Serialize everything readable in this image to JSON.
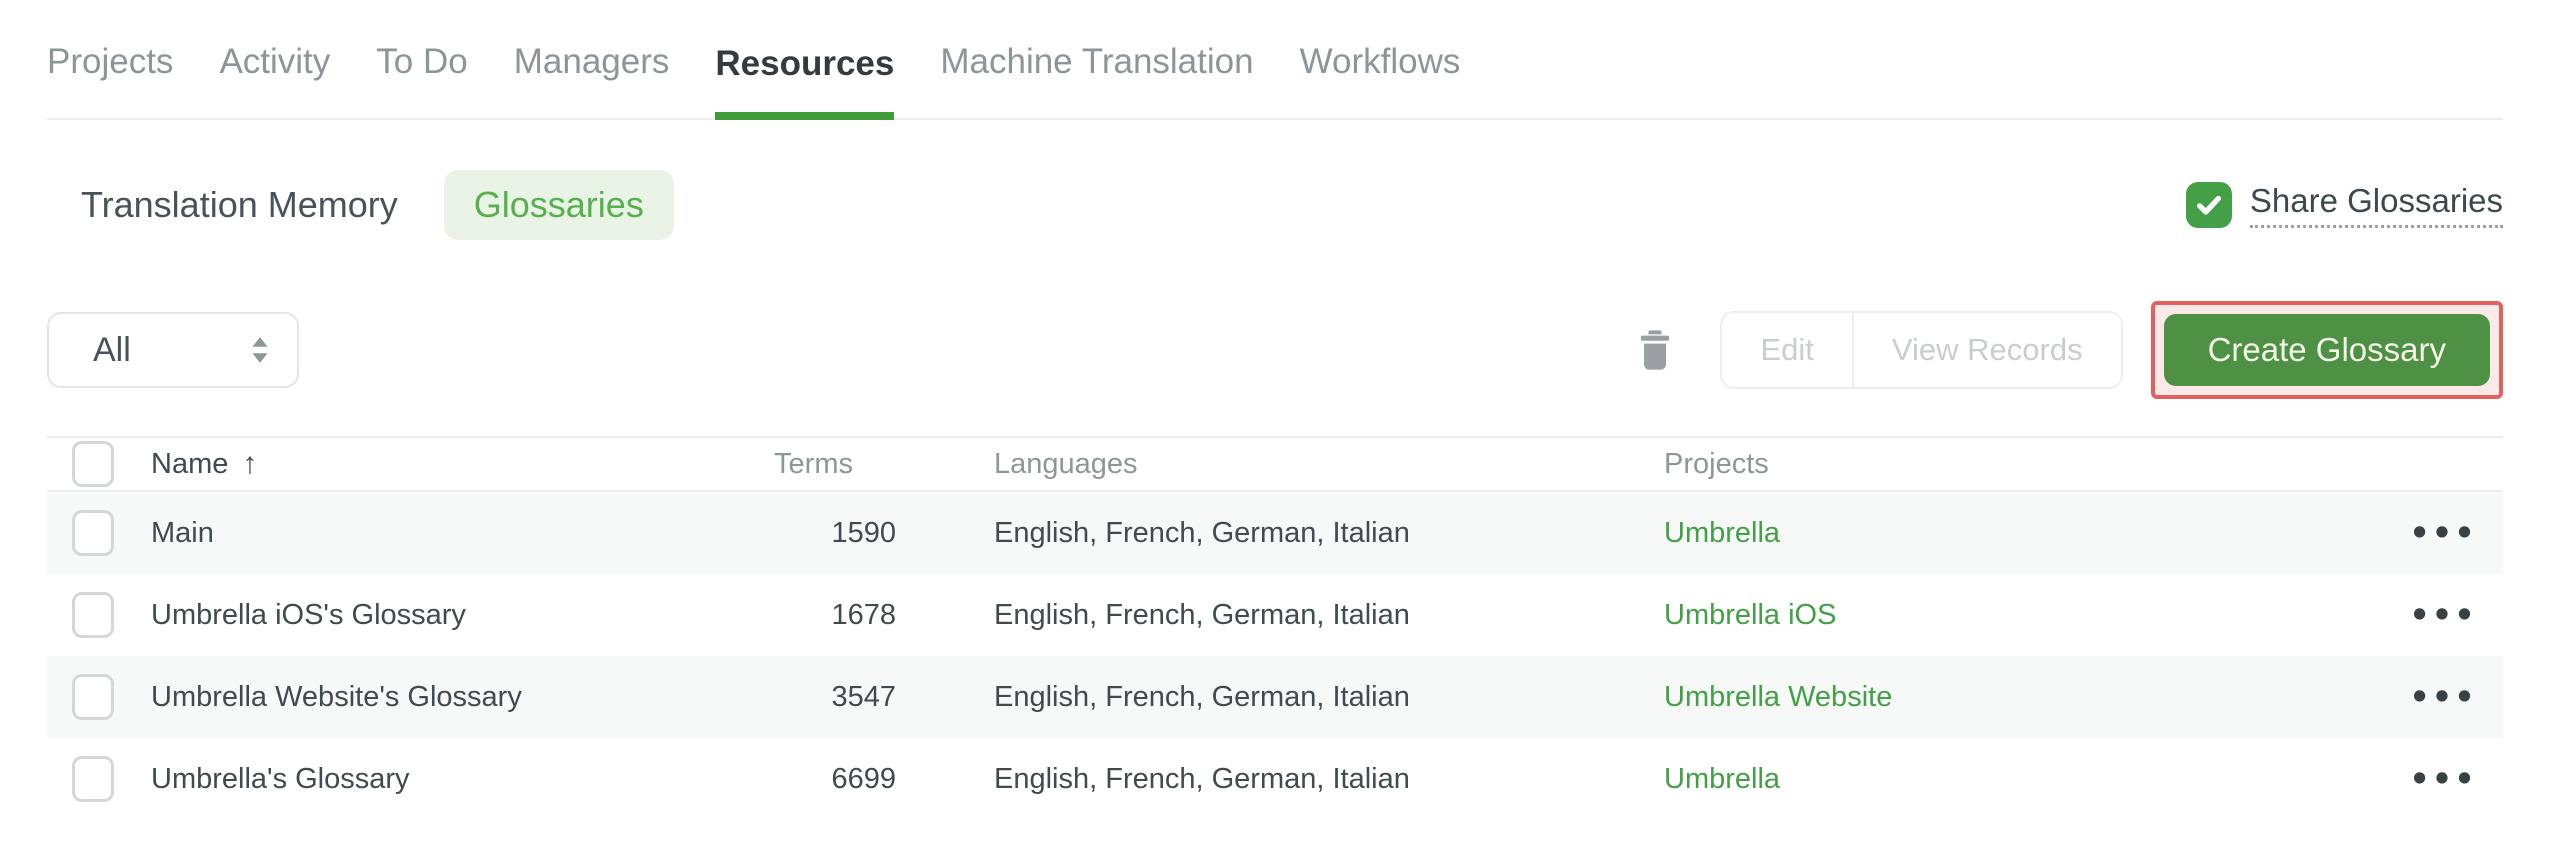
{
  "nav": {
    "tabs": [
      {
        "label": "Projects",
        "active": false
      },
      {
        "label": "Activity",
        "active": false
      },
      {
        "label": "To Do",
        "active": false
      },
      {
        "label": "Managers",
        "active": false
      },
      {
        "label": "Resources",
        "active": true
      },
      {
        "label": "Machine Translation",
        "active": false
      },
      {
        "label": "Workflows",
        "active": false
      }
    ]
  },
  "subnav": {
    "tabs": [
      {
        "label": "Translation Memory",
        "active": false
      },
      {
        "label": "Glossaries",
        "active": true
      }
    ],
    "share": {
      "label": "Share Glossaries",
      "checked": true
    }
  },
  "toolbar": {
    "filter": {
      "value": "All"
    },
    "edit_label": "Edit",
    "view_records_label": "View Records",
    "create_label": "Create Glossary"
  },
  "icons": {
    "trash": "trash-icon",
    "filter_caret": "sort-caret-icon",
    "share_check": "checkmark-icon",
    "sort_asc": "sort-ascending-arrow-icon",
    "row_menu": "ellipsis-icon"
  },
  "table": {
    "columns": [
      "Name",
      "Terms",
      "Languages",
      "Projects"
    ],
    "sort": {
      "column": "Name",
      "direction": "asc",
      "arrow": "↑"
    },
    "row_menu_icon": "•••",
    "rows": [
      {
        "name": "Main",
        "terms": "1590",
        "languages": "English, French, German, Italian",
        "project": "Umbrella"
      },
      {
        "name": "Umbrella iOS's Glossary",
        "terms": "1678",
        "languages": "English, French, German, Italian",
        "project": "Umbrella iOS"
      },
      {
        "name": "Umbrella Website's Glossary",
        "terms": "3547",
        "languages": "English, French, German, Italian",
        "project": "Umbrella Website"
      },
      {
        "name": "Umbrella's Glossary",
        "terms": "6699",
        "languages": "English, French, German, Italian",
        "project": "Umbrella"
      }
    ]
  },
  "colors": {
    "accent-green": "#43a047",
    "button-green": "#4e9144",
    "tab-underline": "#3f9b37",
    "pill-bg": "#e9f4e6",
    "pill-text": "#57b04e",
    "highlight-border": "#e2605e",
    "highlight-bg": "#fbe9e8",
    "row-alt-bg": "#f7f8f8"
  }
}
